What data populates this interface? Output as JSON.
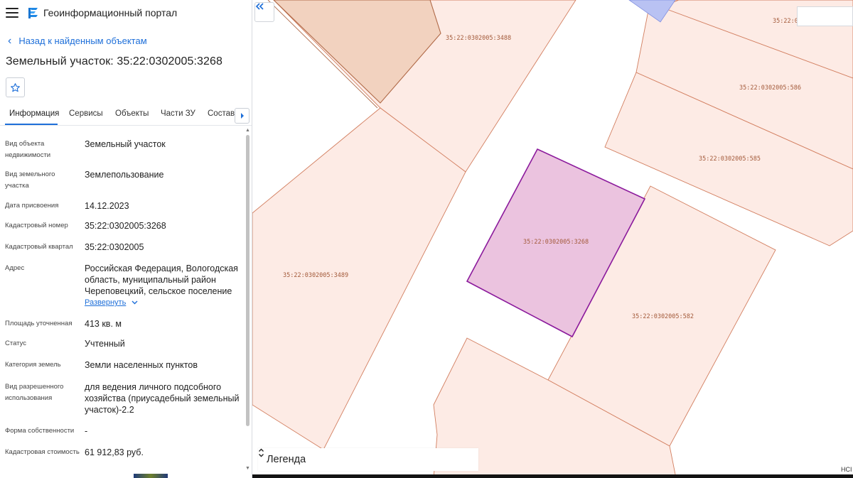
{
  "header": {
    "title": "Геоинформационный портал"
  },
  "nav": {
    "back_label": "Назад к найденным объектам"
  },
  "object": {
    "title": "Земельный участок: 35:22:0302005:3268"
  },
  "tabs": [
    {
      "label": "Информация",
      "active": true
    },
    {
      "label": "Сервисы",
      "active": false
    },
    {
      "label": "Объекты",
      "active": false
    },
    {
      "label": "Части ЗУ",
      "active": false
    },
    {
      "label": "Состав",
      "active": false
    }
  ],
  "fields": [
    {
      "label": "Вид объекта недвижимости",
      "value": "Земельный участок"
    },
    {
      "label": "Вид земельного участка",
      "value": "Землепользование"
    },
    {
      "label": "Дата присвоения",
      "value": "14.12.2023"
    },
    {
      "label": "Кадастровый номер",
      "value": "35:22:0302005:3268"
    },
    {
      "label": "Кадастровый квартал",
      "value": "35:22:0302005"
    },
    {
      "label": "Адрес",
      "value": "Российская Федерация, Вологодская область, муниципальный район Череповецкий, сельское поселение"
    },
    {
      "label": "Площадь уточненная",
      "value": "413 кв. м"
    },
    {
      "label": "Статус",
      "value": "Учтенный"
    },
    {
      "label": "Категория земель",
      "value": "Земли населенных пунктов"
    },
    {
      "label": "Вид разрешенного использования",
      "value": "для ведения личного подсобного хозяйства (приусадебный земельный участок)-2.2"
    },
    {
      "label": "Форма собственности",
      "value": "-"
    },
    {
      "label": "Кадастровая стоимость",
      "value": "61 912,83 руб."
    }
  ],
  "address_expand_label": "Развернуть",
  "map": {
    "parcels": [
      {
        "id": "35:22:0302005:3488"
      },
      {
        "id": "35:22:0302005:3489"
      },
      {
        "id": "35:22:0302005:3268",
        "selected": true
      },
      {
        "id": "35:22:0302005:586"
      },
      {
        "id": "35:22:0302005:585"
      },
      {
        "id": "35:22:0302005:582"
      },
      {
        "id": "35:22:0"
      }
    ],
    "legend_label": "Легенда",
    "corner_text": "НСI",
    "colors": {
      "parcel_fill": "#fdebe5",
      "parcel_stroke": "#d27e5f",
      "selected_fill": "#ebc3df",
      "selected_stroke": "#8b1a9c",
      "adjacent_fill": "#f2d2bf",
      "overlay_blue": "#b9c2f3"
    }
  },
  "icons": {
    "menu": "menu-icon",
    "logo": "portal-logo-icon",
    "back": "chevron-left-icon",
    "favorite": "star-icon",
    "tabs_next": "chevron-right-icon",
    "collapse": "double-chevron-left-icon",
    "legend_toggle": "chevron-up-down-icon",
    "expand": "chevron-down-icon"
  }
}
